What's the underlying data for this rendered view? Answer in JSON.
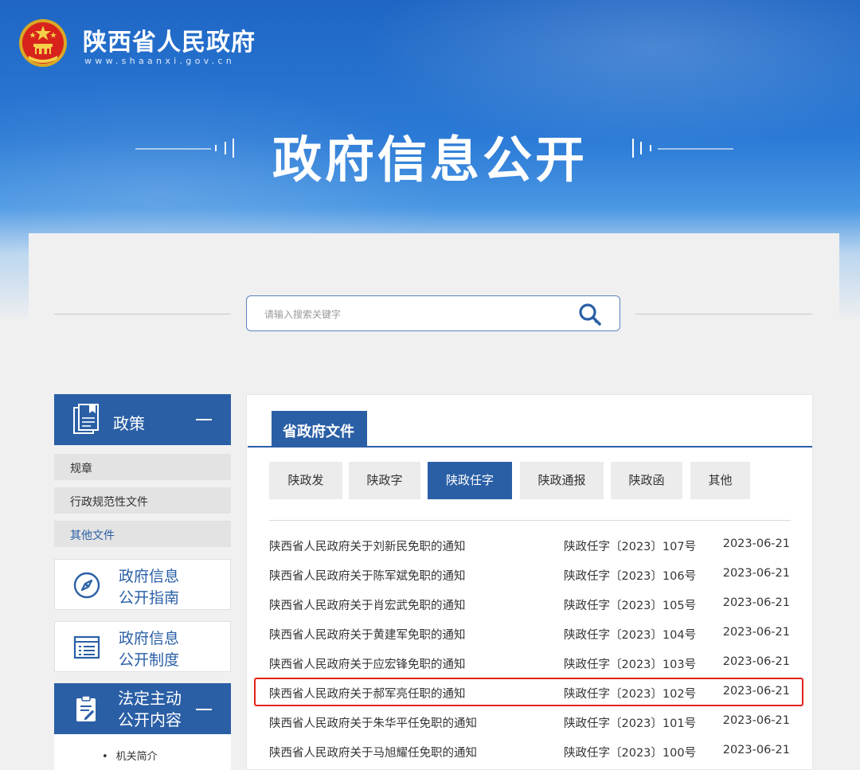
{
  "header": {
    "site_name": "陕西省人民政府",
    "site_url": "www.shaanxi.gov.cn",
    "banner_title": "政府信息公开"
  },
  "search": {
    "placeholder": "请输入搜索关键字"
  },
  "sidebar": {
    "policy": {
      "title": "政策",
      "items": [
        "规章",
        "行政规范性文件",
        "其他文件"
      ],
      "active_item": "其他文件"
    },
    "guide": "政府信息公开指南",
    "guide_lines": [
      "政府信息",
      "公开指南"
    ],
    "system_lines": [
      "政府信息",
      "公开制度"
    ],
    "active_disclosure_lines": [
      "法定主动",
      "公开内容"
    ],
    "active_disclosure_items": [
      "机关简介"
    ]
  },
  "main": {
    "section_tab": "省政府文件",
    "subtabs": [
      "陕政发",
      "陕政字",
      "陕政任字",
      "陕政通报",
      "陕政函",
      "其他"
    ],
    "active_subtab": "陕政任字",
    "documents": [
      {
        "title": "陕西省人民政府关于刘新民免职的通知",
        "code": "陕政任字〔2023〕107号",
        "date": "2023-06-21"
      },
      {
        "title": "陕西省人民政府关于陈军斌免职的通知",
        "code": "陕政任字〔2023〕106号",
        "date": "2023-06-21"
      },
      {
        "title": "陕西省人民政府关于肖宏武免职的通知",
        "code": "陕政任字〔2023〕105号",
        "date": "2023-06-21"
      },
      {
        "title": "陕西省人民政府关于黄建军免职的通知",
        "code": "陕政任字〔2023〕104号",
        "date": "2023-06-21"
      },
      {
        "title": "陕西省人民政府关于应宏锋免职的通知",
        "code": "陕政任字〔2023〕103号",
        "date": "2023-06-21"
      },
      {
        "title": "陕西省人民政府关于郝军亮任职的通知",
        "code": "陕政任字〔2023〕102号",
        "date": "2023-06-21"
      },
      {
        "title": "陕西省人民政府关于朱华平任免职的通知",
        "code": "陕政任字〔2023〕101号",
        "date": "2023-06-21"
      },
      {
        "title": "陕西省人民政府关于马旭耀任免职的通知",
        "code": "陕政任字〔2023〕100号",
        "date": "2023-06-21"
      }
    ],
    "highlighted_index": 5
  },
  "colors": {
    "brand_blue": "#2a5fa6",
    "highlight_red": "#e2231a"
  }
}
